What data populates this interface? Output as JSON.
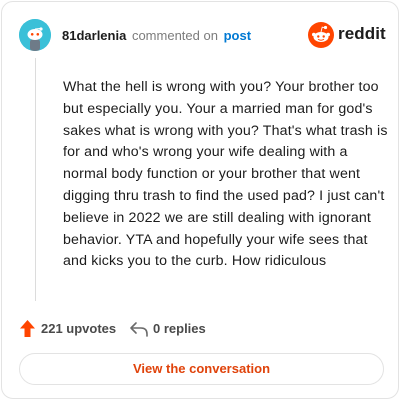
{
  "header": {
    "username": "81darlenia",
    "action_text": "commented on",
    "post_link": "post",
    "brand": "reddit"
  },
  "comment": {
    "body": "What the hell is wrong with you? Your brother too but especially you. Your a married man for god's sakes what is wrong with you? That's what trash is for and who's wrong your wife dealing with a normal body function or your brother that went digging thru trash to find the used pad? I just can't believe in 2022 we are still dealing with ignorant behavior. YTA and hopefully your wife sees that and kicks you to the curb. How ridiculous"
  },
  "actions": {
    "upvotes": "221 upvotes",
    "replies": "0 replies"
  },
  "cta": {
    "label": "View the conversation"
  },
  "colors": {
    "accent": "#ff4500",
    "link": "#0079d3",
    "cta_text": "#e0430b",
    "avatar_bg": "#3ac0d8"
  },
  "icons": [
    "snoo-avatar-icon",
    "reddit-logo-icon",
    "upvote-arrow-icon",
    "reply-arrow-icon"
  ]
}
